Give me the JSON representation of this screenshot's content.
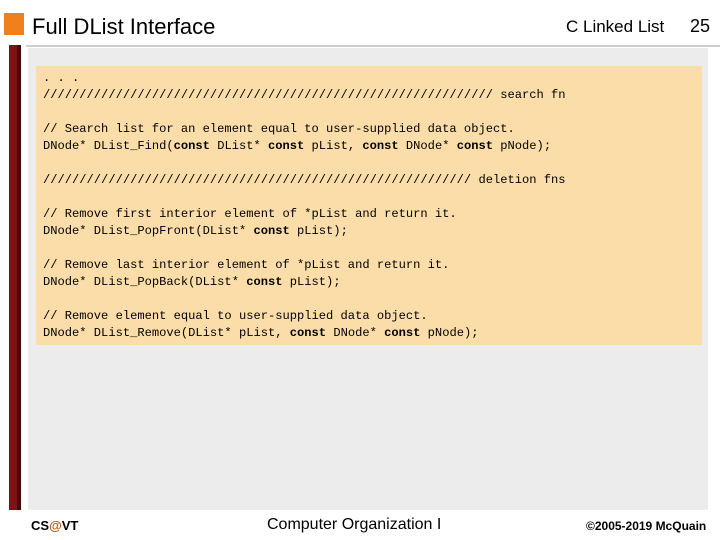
{
  "header": {
    "title": "Full DList Interface",
    "topic": "C Linked List",
    "page_number": "25"
  },
  "code": {
    "lines": [
      [
        {
          "t": ". . ."
        }
      ],
      [
        {
          "t": "////////////////////////////////////////////////////////////// search fn"
        }
      ],
      [
        {
          "t": ""
        }
      ],
      [
        {
          "t": "// Search list for an element equal to user-supplied data object."
        }
      ],
      [
        {
          "t": "DNode* DList_Find("
        },
        {
          "t": "const",
          "kw": true
        },
        {
          "t": " DList* "
        },
        {
          "t": "const",
          "kw": true
        },
        {
          "t": " pList, "
        },
        {
          "t": "const",
          "kw": true
        },
        {
          "t": " DNode* "
        },
        {
          "t": "const",
          "kw": true
        },
        {
          "t": " pNode);"
        }
      ],
      [
        {
          "t": ""
        }
      ],
      [
        {
          "t": "/////////////////////////////////////////////////////////// deletion fns"
        }
      ],
      [
        {
          "t": ""
        }
      ],
      [
        {
          "t": "// Remove first interior element of *pList and return it."
        }
      ],
      [
        {
          "t": "DNode* DList_PopFront(DList* "
        },
        {
          "t": "const",
          "kw": true
        },
        {
          "t": " pList);"
        }
      ],
      [
        {
          "t": ""
        }
      ],
      [
        {
          "t": "// Remove last interior element of *pList and return it."
        }
      ],
      [
        {
          "t": "DNode* DList_PopBack(DList* "
        },
        {
          "t": "const",
          "kw": true
        },
        {
          "t": " pList);"
        }
      ],
      [
        {
          "t": ""
        }
      ],
      [
        {
          "t": "// Remove element equal to user-supplied data object."
        }
      ],
      [
        {
          "t": "DNode* DList_Remove(DList* pList, "
        },
        {
          "t": "const",
          "kw": true
        },
        {
          "t": " DNode* "
        },
        {
          "t": "const",
          "kw": true
        },
        {
          "t": " pNode);"
        }
      ]
    ]
  },
  "footer": {
    "left_prefix": "CS",
    "left_at": "@",
    "left_suffix": "VT",
    "center": "Computer Organization I",
    "right": "©2005-2019 McQuain"
  },
  "colors": {
    "accent_orange": "#f07f1e",
    "code_background": "#fbddaa",
    "left_bar": "#7b1414"
  }
}
